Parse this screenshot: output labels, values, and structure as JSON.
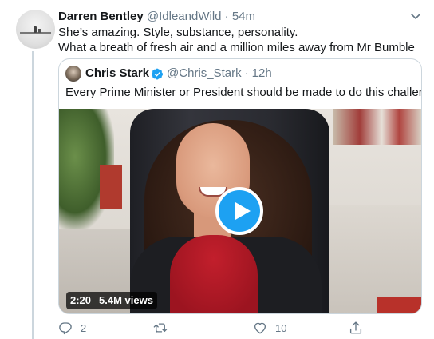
{
  "tweet": {
    "author_name": "Darren Bentley",
    "author_handle": "@IdleandWild",
    "separator": "·",
    "time": "54m",
    "lines": [
      "She’s amazing. Style, substance, personality.",
      "What a breath of fresh air and a million miles away from Mr Bumble"
    ],
    "icons": {
      "more": "chevron-down-icon",
      "reply": "reply-icon",
      "retweet": "retweet-icon",
      "like": "heart-icon",
      "share": "share-icon"
    },
    "counts": {
      "replies": "2",
      "likes": "10"
    }
  },
  "quoted": {
    "author_name": "Chris Stark",
    "author_handle": "@Chris_Stark",
    "separator": "·",
    "time": "12h",
    "verified": true,
    "text": "Every Prime Minister or President should be made to do this challenge...",
    "video": {
      "duration": "2:20",
      "views": "5.4M views",
      "play_icon": "play-icon"
    }
  },
  "colors": {
    "accent": "#1da1f2",
    "muted": "#657786",
    "border": "#ccd6dd",
    "text": "#14171a"
  }
}
